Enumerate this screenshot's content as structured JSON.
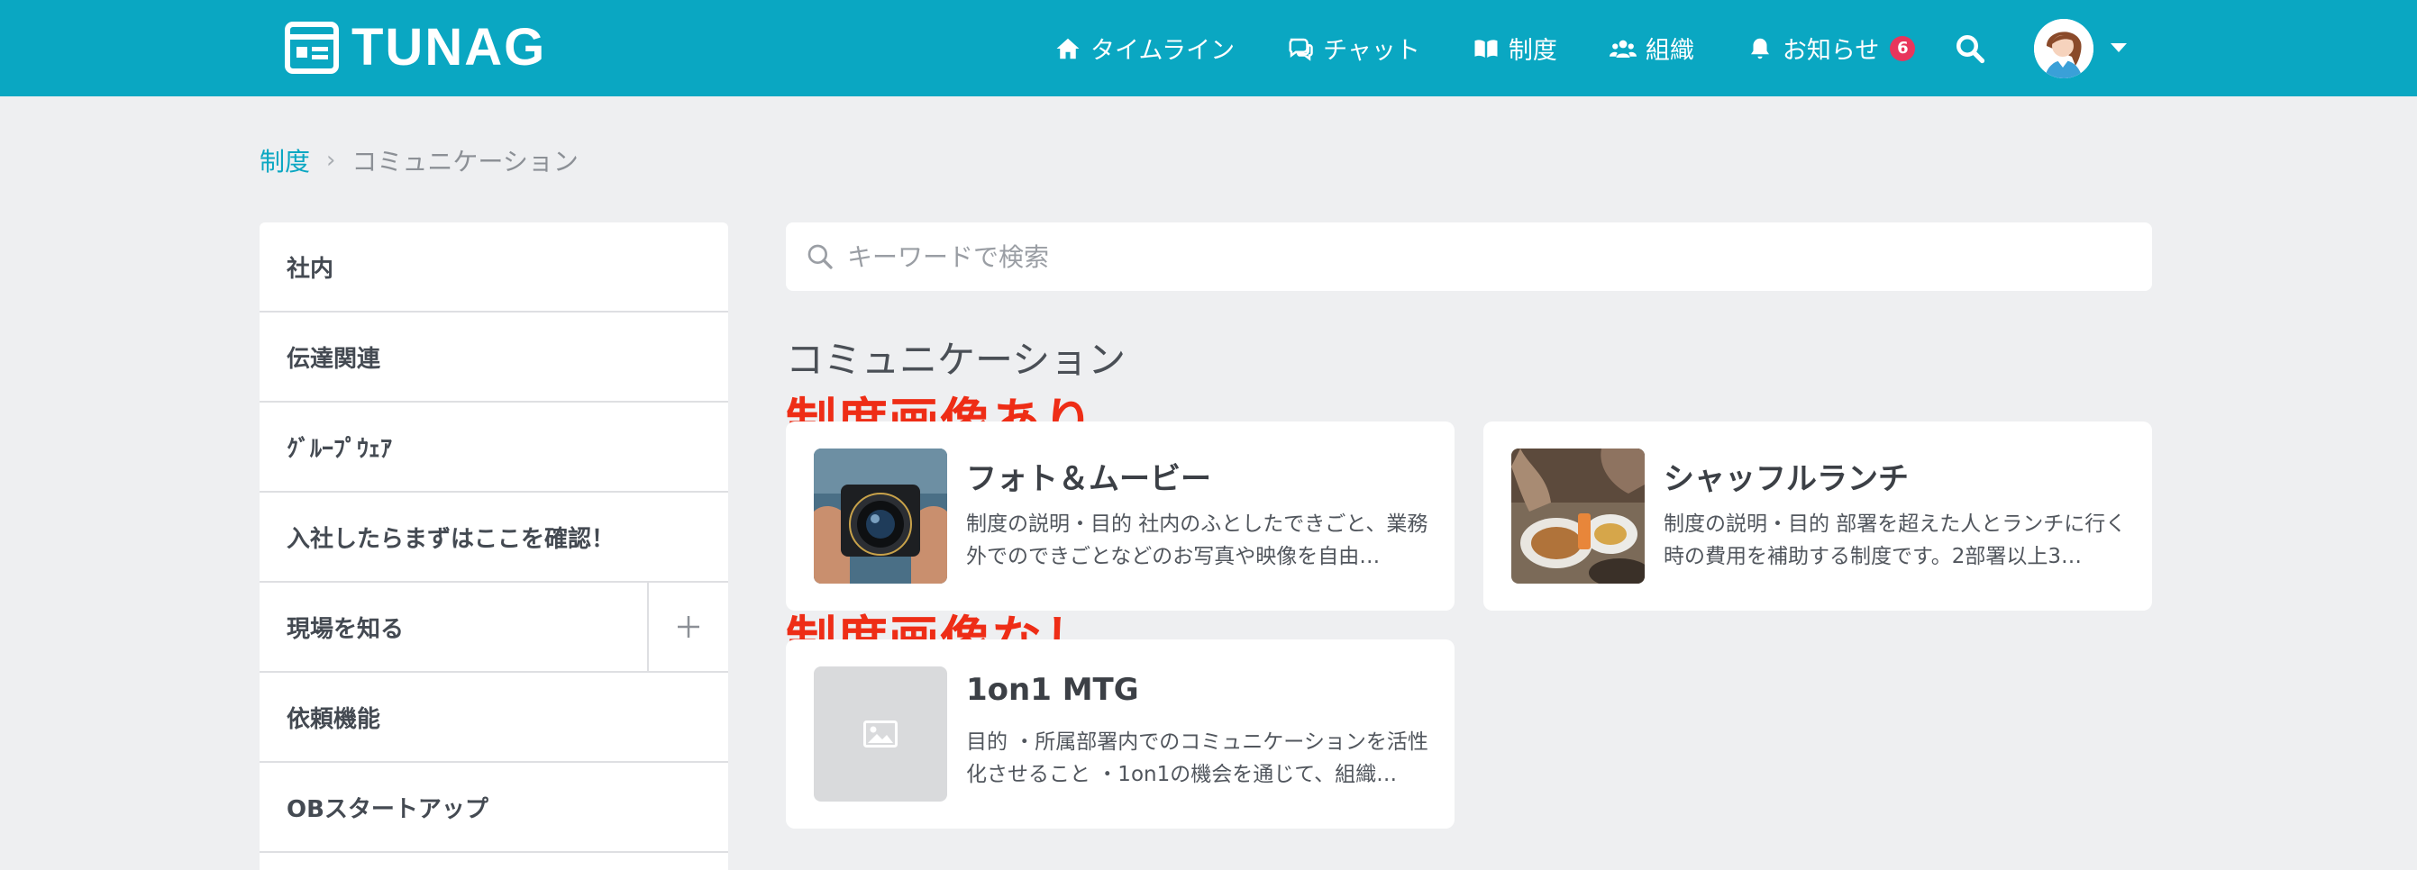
{
  "brand": {
    "name": "TUNAG",
    "header_color": "#0aa7c2"
  },
  "nav": [
    {
      "label": "タイムライン",
      "icon": "home-icon"
    },
    {
      "label": "チャット",
      "icon": "chat-icon"
    },
    {
      "label": "制度",
      "icon": "book-icon"
    },
    {
      "label": "組織",
      "icon": "users-icon"
    },
    {
      "label": "お知らせ",
      "icon": "bell-icon",
      "badge": "6"
    }
  ],
  "breadcrumb": {
    "parent": "制度",
    "separator": "›",
    "current": "コミュニケーション"
  },
  "sidebar": {
    "items": [
      {
        "label": "社内"
      },
      {
        "label": "伝達関連"
      },
      {
        "label": "ｸﾞﾙｰﾌﾟｳｪｱ"
      },
      {
        "label": "入社したらまずはここを確認！"
      },
      {
        "label": "現場を知る",
        "expandable": true
      },
      {
        "label": "依頼機能"
      },
      {
        "label": "OBスタートアップ"
      }
    ]
  },
  "search": {
    "placeholder": "キーワードで検索"
  },
  "section": {
    "title": "コミュニケーション"
  },
  "annotations": {
    "with_image": "制度画像あり",
    "without_image": "制度画像なし"
  },
  "cards": [
    {
      "title": "フォト＆ムービー",
      "description": "制度の説明・目的 社内のふとしたできごと、業務外でのできごとなどのお写真や映像を自由…",
      "thumbnail": "camera-photo"
    },
    {
      "title": "シャッフルランチ",
      "description": "制度の説明・目的 部署を超えた人とランチに行く時の費用を補助する制度です。2部署以上3…",
      "thumbnail": "lunch-photo"
    },
    {
      "title": "1on1 MTG",
      "description": "目的 ・所属部署内でのコミュニケーションを活性化させること ・1on1の機会を通じて、組織…",
      "thumbnail": "image-placeholder-icon"
    }
  ],
  "colors": {
    "accent": "#0aa7c2",
    "badge": "#e8365c",
    "annotation": "#ee2d16",
    "background": "#eeeff1"
  }
}
